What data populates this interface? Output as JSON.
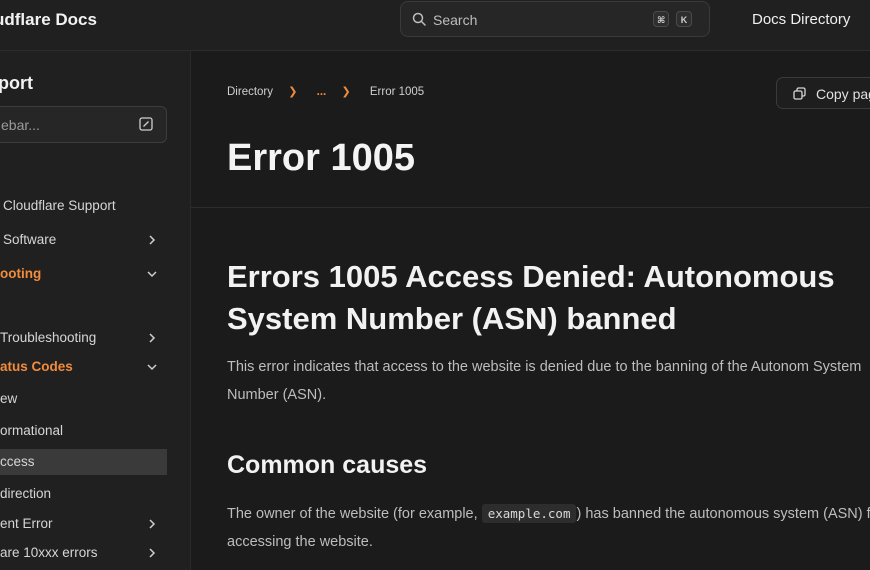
{
  "header": {
    "brand": "udflare Docs",
    "search_placeholder": "Search",
    "kbd_cmd": "⌘",
    "kbd_k": "K",
    "docs_directory": "Docs Directory"
  },
  "sidebar": {
    "title": "port",
    "filter_placeholder": "ebar...",
    "items": [
      {
        "label": "",
        "chevron": "none"
      },
      {
        "label": "Cloudflare Support",
        "chevron": "none"
      },
      {
        "label": "Software",
        "chevron": "right"
      },
      {
        "label": "ooting",
        "chevron": "down",
        "accent": true
      },
      {
        "label": "",
        "chevron": "none"
      },
      {
        "label": "Troubleshooting",
        "chevron": "right"
      },
      {
        "label": "atus Codes",
        "chevron": "down",
        "accent": true
      },
      {
        "label": "ew",
        "chevron": "none"
      },
      {
        "label": "ormational",
        "chevron": "none"
      },
      {
        "label": "ccess",
        "chevron": "none",
        "active": true
      },
      {
        "label": "direction",
        "chevron": "none"
      },
      {
        "label": "ent Error",
        "chevron": "right"
      },
      {
        "label": "are 10xxx errors",
        "chevron": "right"
      }
    ]
  },
  "main": {
    "breadcrumb": {
      "first": "Directory",
      "ellipsis": "...",
      "current": "Error 1005"
    },
    "copy_button": "Copy pag",
    "title": "Error 1005",
    "section_title": "Errors 1005 Access Denied: Autonomous System Number (ASN) banned",
    "intro": "This error indicates that access to the website is denied due to the banning of the Autonom System Number (ASN).",
    "causes_title": "Common causes",
    "causes_pre": "The owner of the website (for example, ",
    "causes_code": "example.com",
    "causes_post": ") has banned the autonomous system (ASN) from accessing the website."
  },
  "colors": {
    "accent": "#f28b3b",
    "background": "#1b1b1b",
    "sidebar": "#202020"
  }
}
